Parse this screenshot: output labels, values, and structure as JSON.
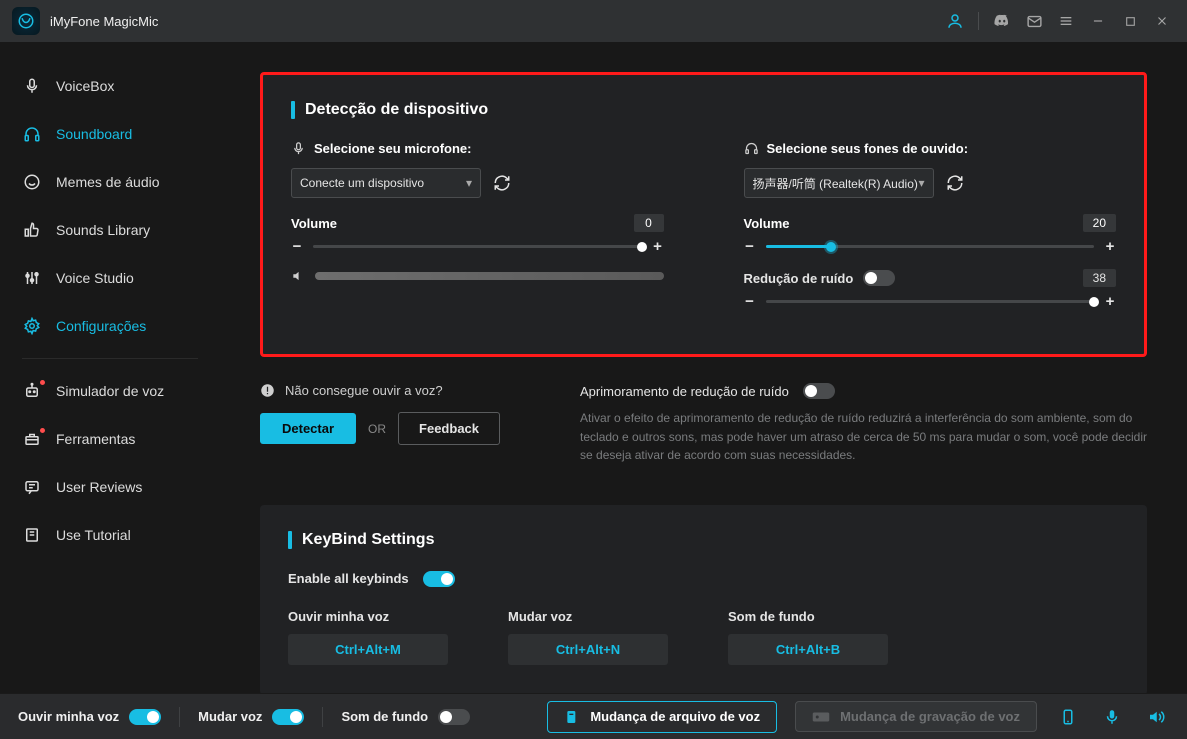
{
  "app": {
    "title": "iMyFone MagicMic"
  },
  "sidebar": {
    "items": [
      {
        "label": "VoiceBox"
      },
      {
        "label": "Soundboard"
      },
      {
        "label": "Memes de áudio"
      },
      {
        "label": "Sounds Library"
      },
      {
        "label": "Voice Studio"
      },
      {
        "label": "Configurações"
      },
      {
        "label": "Simulador de voz"
      },
      {
        "label": "Ferramentas"
      },
      {
        "label": "User Reviews"
      },
      {
        "label": "Use Tutorial"
      }
    ]
  },
  "device": {
    "title": "Detecção de dispositivo",
    "mic": {
      "label": "Selecione seu microfone:",
      "value": "Conecte um dispositivo",
      "volume_label": "Volume",
      "volume": "0"
    },
    "headphone": {
      "label": "Selecione seus fones de ouvido:",
      "value": "扬声器/听筒 (Realtek(R) Audio)",
      "volume_label": "Volume",
      "volume": "20",
      "noise_label": "Redução de ruído",
      "noise_value": "38"
    }
  },
  "help": {
    "question": "Não consegue ouvir a voz?",
    "detect": "Detectar",
    "or": "OR",
    "feedback": "Feedback",
    "enhance_label": "Aprimoramento de redução de ruído",
    "enhance_desc": "Ativar o efeito de aprimoramento de redução de ruído reduzirá a interferência do som ambiente, som do teclado e outros sons, mas pode haver um atraso de cerca de 50 ms para mudar o som, você pode decidir se deseja ativar de acordo com suas necessidades."
  },
  "keybind": {
    "title": "KeyBind Settings",
    "enable_label": "Enable all keybinds",
    "items": [
      {
        "label": "Ouvir minha voz",
        "key": "Ctrl+Alt+M"
      },
      {
        "label": "Mudar voz",
        "key": "Ctrl+Alt+N"
      },
      {
        "label": "Som de fundo",
        "key": "Ctrl+Alt+B"
      }
    ]
  },
  "footer": {
    "hear": "Ouvir minha voz",
    "change": "Mudar voz",
    "bg": "Som de fundo",
    "filechange": "Mudança de arquivo de voz",
    "recchange": "Mudança de gravação de voz"
  }
}
